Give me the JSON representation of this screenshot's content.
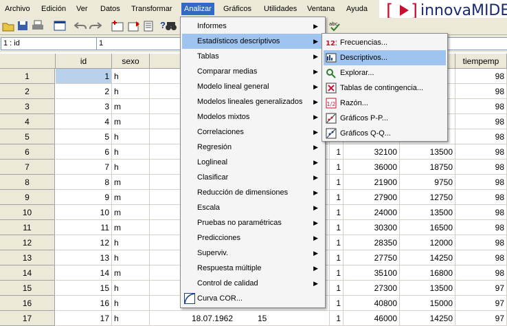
{
  "menubar": [
    "Archivo",
    "Edición",
    "Ver",
    "Datos",
    "Transformar",
    "Analizar",
    "Gráficos",
    "Utilidades",
    "Ventana",
    "Ayuda"
  ],
  "active_menu": "Analizar",
  "logo": {
    "bracket_open": "[",
    "bracket_close": "]",
    "text": "innovaMIDE"
  },
  "cellbar": {
    "ref": "1 : id",
    "value": "1"
  },
  "columns": {
    "id": "id",
    "sexo": "sexo",
    "tiempemp": "tiempemp"
  },
  "rows": [
    {
      "n": "1",
      "id": "1",
      "sexo": "h",
      "c2": "",
      "c3": "",
      "c4": "",
      "right": "98"
    },
    {
      "n": "2",
      "id": "2",
      "sexo": "h",
      "c2": "",
      "c3": "",
      "c4": "",
      "right": "98"
    },
    {
      "n": "3",
      "id": "3",
      "sexo": "m",
      "c2": "",
      "c3": "",
      "c4": "",
      "right": "98"
    },
    {
      "n": "4",
      "id": "4",
      "sexo": "m",
      "c2": "",
      "c3": "",
      "c4": "",
      "right": "98"
    },
    {
      "n": "5",
      "id": "5",
      "sexo": "h",
      "c2": "",
      "c3": "",
      "c4": "",
      "right": "98"
    },
    {
      "n": "6",
      "id": "6",
      "sexo": "h",
      "c2": "1",
      "c3": "32100",
      "c4": "13500",
      "right": "98"
    },
    {
      "n": "7",
      "id": "7",
      "sexo": "h",
      "c2": "1",
      "c3": "36000",
      "c4": "18750",
      "right": "98"
    },
    {
      "n": "8",
      "id": "8",
      "sexo": "m",
      "c2": "1",
      "c3": "21900",
      "c4": "9750",
      "right": "98"
    },
    {
      "n": "9",
      "id": "9",
      "sexo": "m",
      "c2": "1",
      "c3": "27900",
      "c4": "12750",
      "right": "98"
    },
    {
      "n": "10",
      "id": "10",
      "sexo": "m",
      "c2": "1",
      "c3": "24000",
      "c4": "13500",
      "right": "98"
    },
    {
      "n": "11",
      "id": "11",
      "sexo": "m",
      "c2": "1",
      "c3": "30300",
      "c4": "16500",
      "right": "98"
    },
    {
      "n": "12",
      "id": "12",
      "sexo": "h",
      "c2": "1",
      "c3": "28350",
      "c4": "12000",
      "right": "98"
    },
    {
      "n": "13",
      "id": "13",
      "sexo": "h",
      "c2": "1",
      "c3": "27750",
      "c4": "14250",
      "right": "98"
    },
    {
      "n": "14",
      "id": "14",
      "sexo": "m",
      "c2": "1",
      "c3": "35100",
      "c4": "16800",
      "right": "98"
    },
    {
      "n": "15",
      "id": "15",
      "sexo": "h",
      "c2": "1",
      "c3": "27300",
      "c4": "13500",
      "right": "97"
    },
    {
      "n": "16",
      "id": "16",
      "sexo": "h",
      "c2": "1",
      "c3": "40800",
      "c4": "15000",
      "right": "97"
    },
    {
      "n": "17",
      "id": "17",
      "sexo": "h",
      "c2": "1",
      "c3": "46000",
      "c4": "14250",
      "right": "97"
    }
  ],
  "row17_extra": {
    "date": "18.07.1962",
    "num": "15"
  },
  "analizar_menu": [
    "Informes",
    "Estadísticos descriptivos",
    "Tablas",
    "Comparar medias",
    "Modelo lineal general",
    "Modelos lineales generalizados",
    "Modelos mixtos",
    "Correlaciones",
    "Regresión",
    "Loglineal",
    "Clasificar",
    "Reducción de dimensiones",
    "Escala",
    "Pruebas no paramétricas",
    "Predicciones",
    "Superviv.",
    "Respuesta múltiple",
    "Control de calidad",
    "Curva COR..."
  ],
  "descriptivos_submenu": [
    {
      "label": "Frecuencias...",
      "icon": "123"
    },
    {
      "label": "Descriptivos...",
      "icon": "descriptives"
    },
    {
      "label": "Explorar...",
      "icon": "explore"
    },
    {
      "label": "Tablas de contingencia...",
      "icon": "crosstab"
    },
    {
      "label": "Razón...",
      "icon": "1/2"
    },
    {
      "label": "Gráficos P-P...",
      "icon": "pp-plot"
    },
    {
      "label": "Gráficos Q-Q...",
      "icon": "qq-plot"
    }
  ]
}
